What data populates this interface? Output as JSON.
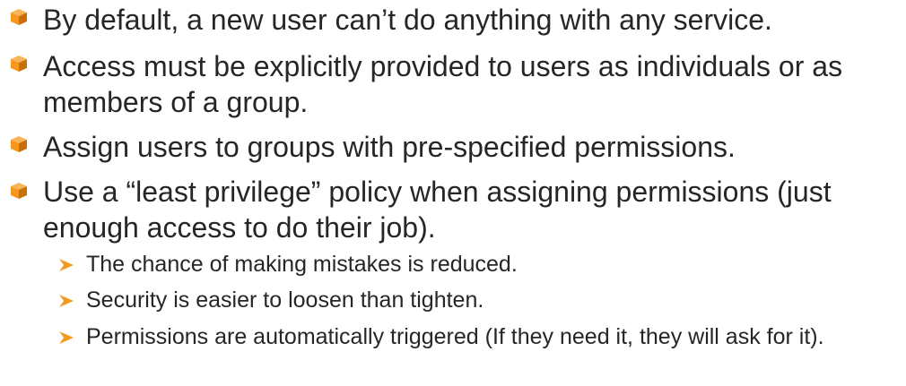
{
  "colors": {
    "text": "#262626",
    "bullet_orange": "#F7981D",
    "bullet_dark": "#C96F0A",
    "arrow_orange": "#F29B21"
  },
  "icons": {
    "main_bullet": "orange-cube-icon",
    "sub_bullet": "arrow-right-icon"
  },
  "bullets": [
    {
      "text": "By default, a new user can’t do anything with any service."
    },
    {
      "text": "Access must be explicitly provided to users as individuals or as members of a group."
    },
    {
      "text": "Assign users to groups with pre-specified permissions."
    },
    {
      "text": "Use a “least privilege” policy when assigning permissions (just enough access to do their job)."
    }
  ],
  "sub_bullets": [
    {
      "text": "The chance of making mistakes is reduced."
    },
    {
      "text": "Security is easier to loosen than tighten."
    },
    {
      "text": "Permissions are automatically triggered (If they need it, they will ask for it)."
    }
  ]
}
